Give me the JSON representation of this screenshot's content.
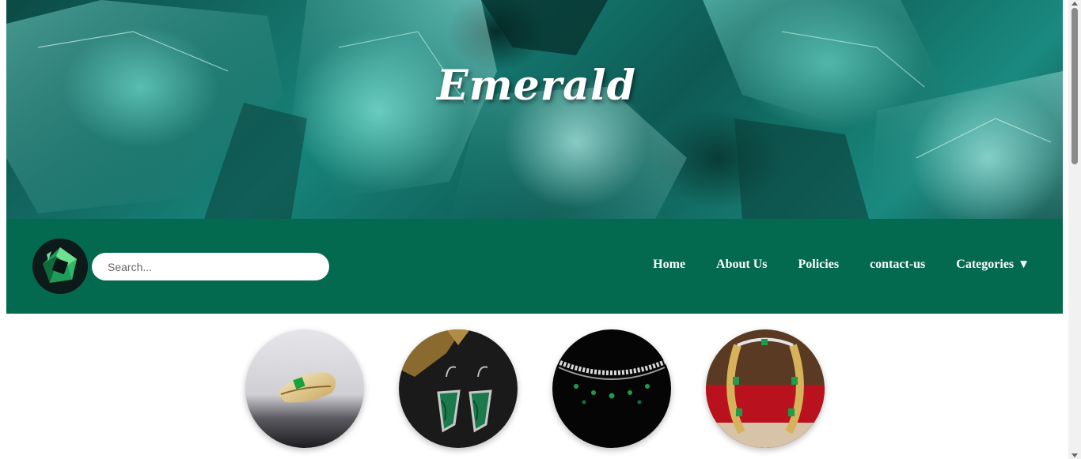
{
  "hero": {
    "title": "Emerald"
  },
  "header": {
    "logo_icon": "emerald-gem-logo-icon",
    "search": {
      "placeholder": "Search...",
      "value": ""
    },
    "nav": [
      {
        "label": "Home"
      },
      {
        "label": "About Us"
      },
      {
        "label": "Policies"
      },
      {
        "label": "contact-us"
      },
      {
        "label": "Categories",
        "icon": "triangle-down-icon",
        "glyph": "▼"
      }
    ]
  },
  "categories": [
    {
      "name": "ring"
    },
    {
      "name": "earrings"
    },
    {
      "name": "necklace"
    },
    {
      "name": "bracelet"
    }
  ],
  "colors": {
    "navbar": "#046a4f",
    "nav_text": "#ffffff",
    "hero_teal": "#17837a"
  }
}
